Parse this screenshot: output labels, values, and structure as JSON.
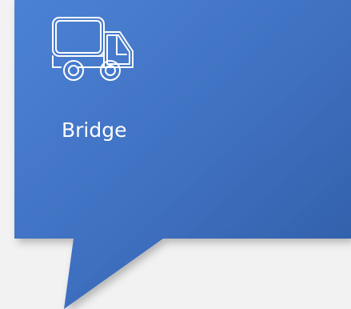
{
  "callout": {
    "label": "Bridge",
    "icon": "truck-icon",
    "fill_color_top": "#4a7fd2",
    "fill_color_bottom": "#305fa7",
    "text_color": "#ffffff"
  }
}
